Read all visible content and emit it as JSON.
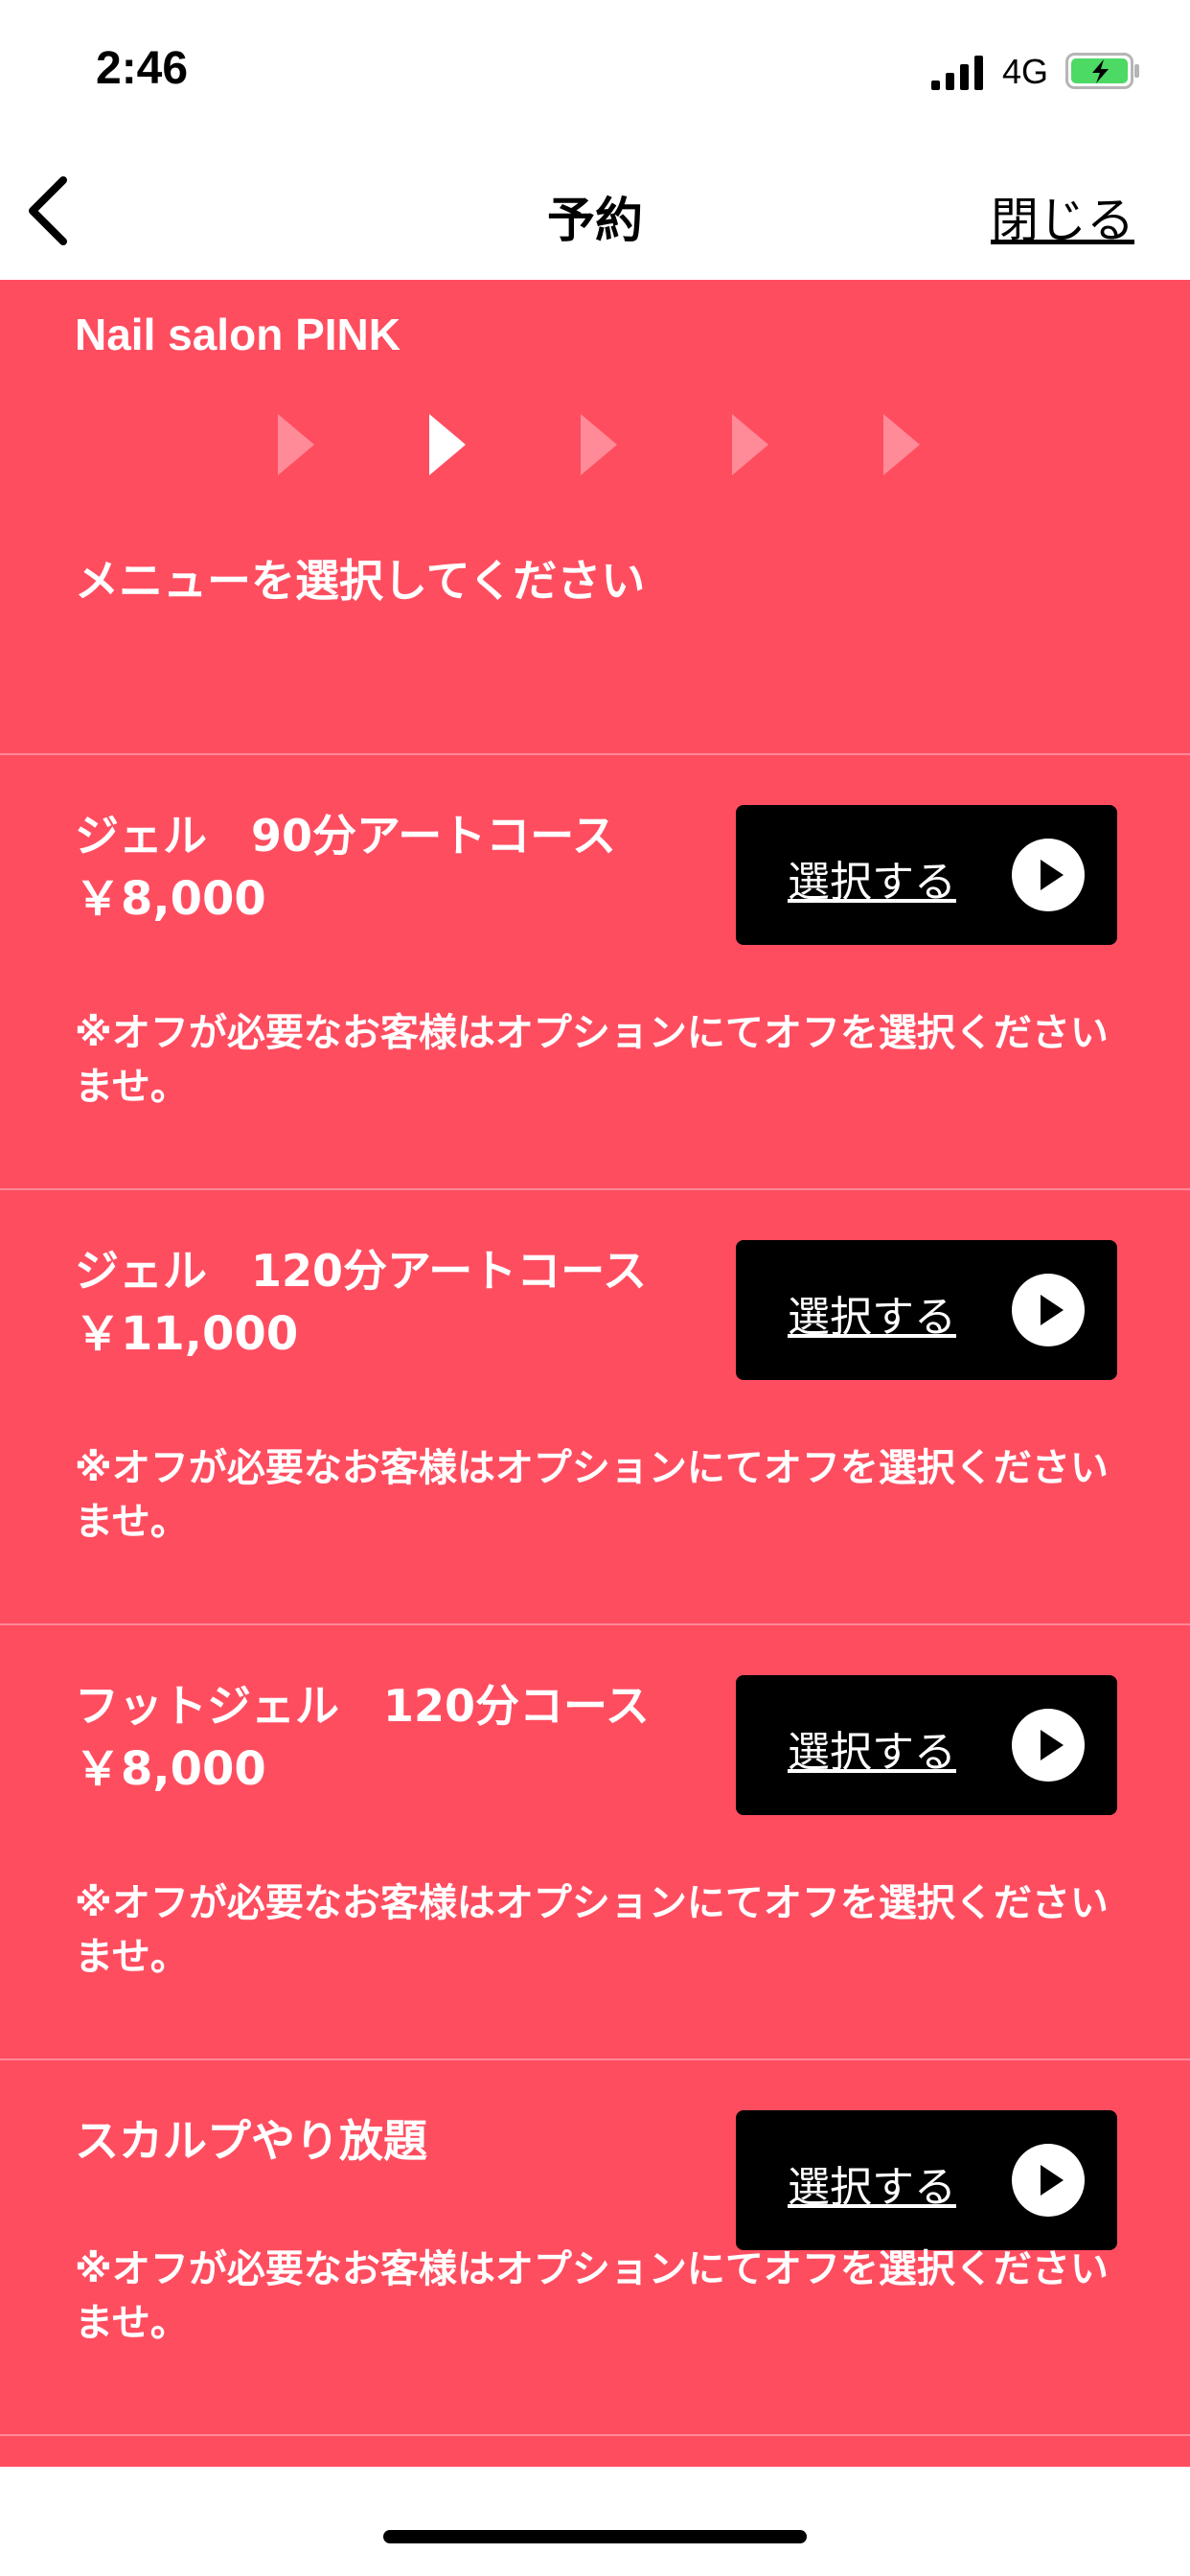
{
  "status_bar": {
    "time": "2:46",
    "network": "4G",
    "battery_color": "#4cd964"
  },
  "nav": {
    "title": "予約",
    "close_label": "閉じる"
  },
  "salon": {
    "name": "Nail salon PINK"
  },
  "steps": {
    "count": 5,
    "active_index": 1
  },
  "instruction": "メニューを選択してください",
  "menu_items": [
    {
      "name": "ジェル　90分アートコース",
      "price": "￥8,000",
      "note": "※オフが必要なお客様はオプションにてオフを選択くださいませ。",
      "button_label": "選択する"
    },
    {
      "name": "ジェル　120分アートコース",
      "price": "￥11,000",
      "note": "※オフが必要なお客様はオプションにてオフを選択くださいませ。",
      "button_label": "選択する"
    },
    {
      "name": "フットジェル　120分コース",
      "price": "￥8,000",
      "note": "※オフが必要なお客様はオプションにてオフを選択くださいませ。",
      "button_label": "選択する"
    },
    {
      "name": "スカルプやり放題",
      "price": "",
      "note": "※オフが必要なお客様はオプションにてオフを選択くださいませ。",
      "button_label": "選択する"
    }
  ],
  "colors": {
    "accent": "#ff4d60",
    "button": "#000000"
  }
}
